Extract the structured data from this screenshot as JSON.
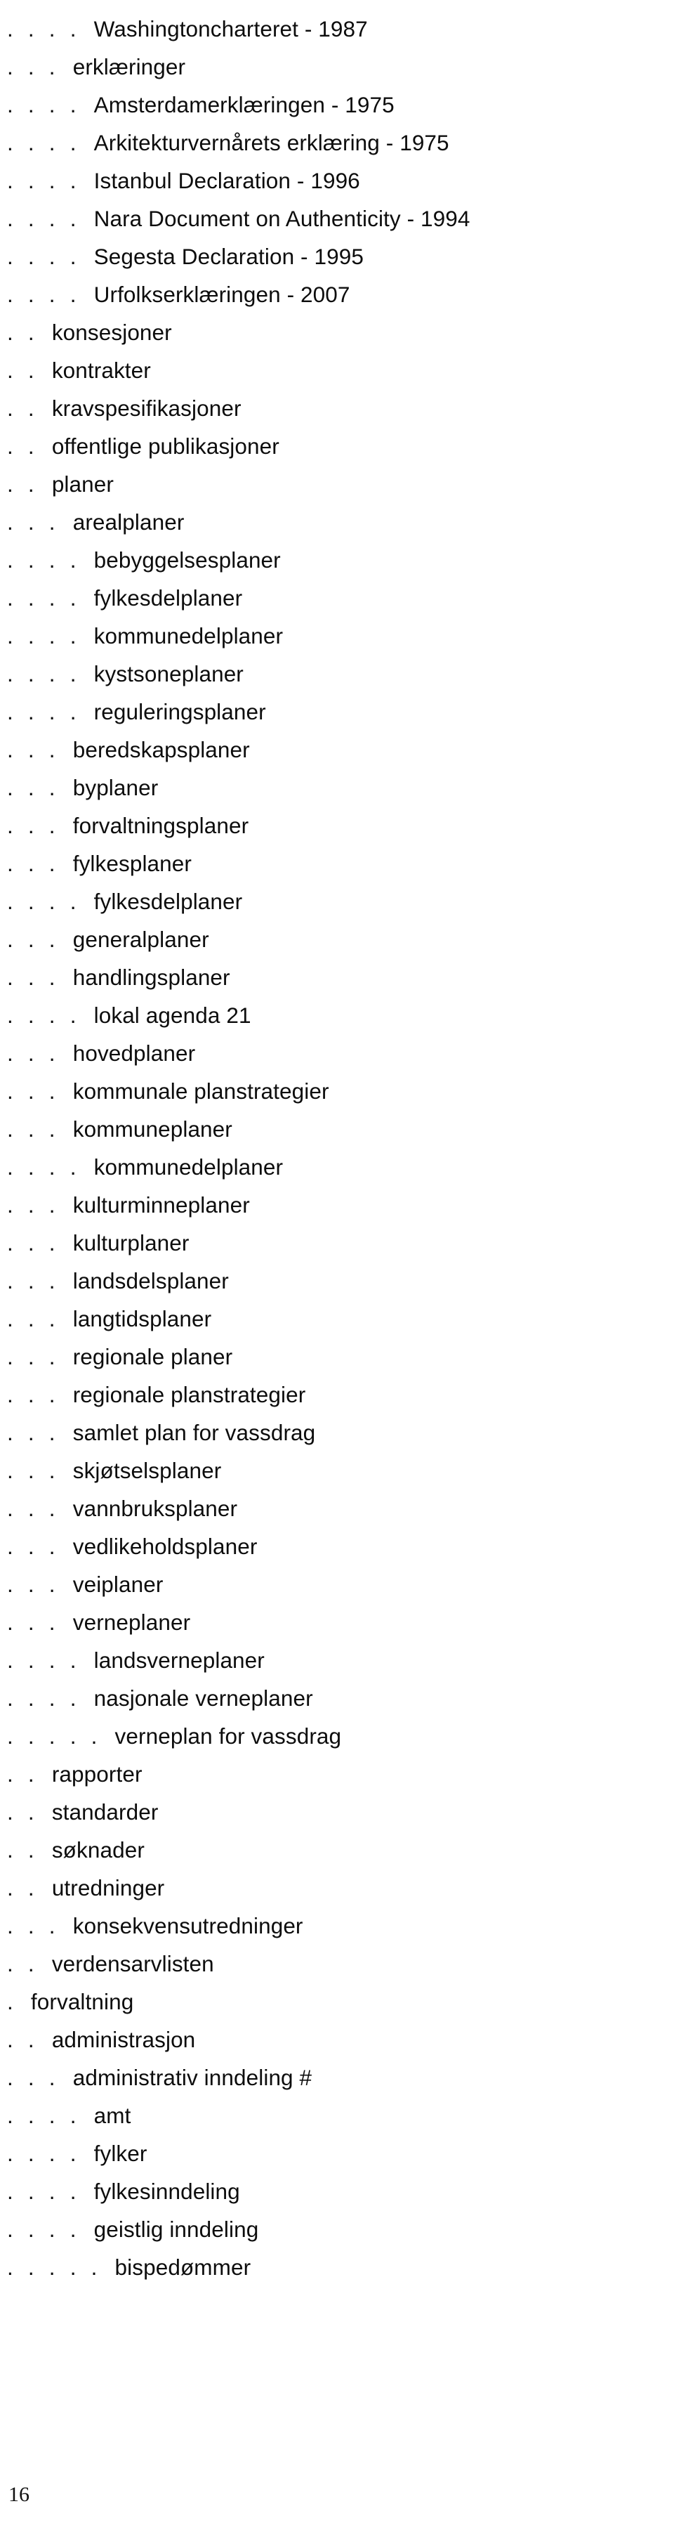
{
  "page": {
    "page_number": "16",
    "dot_char": "."
  },
  "entries": [
    {
      "depth": 4,
      "label": "Washingtoncharteret - 1987"
    },
    {
      "depth": 3,
      "label": "erklæringer"
    },
    {
      "depth": 4,
      "label": "Amsterdamerklæringen - 1975"
    },
    {
      "depth": 4,
      "label": "Arkitekturvernårets erklæring - 1975"
    },
    {
      "depth": 4,
      "label": "Istanbul Declaration - 1996"
    },
    {
      "depth": 4,
      "label": "Nara Document on Authenticity - 1994"
    },
    {
      "depth": 4,
      "label": "Segesta Declaration - 1995"
    },
    {
      "depth": 4,
      "label": "Urfolkserklæringen - 2007"
    },
    {
      "depth": 2,
      "label": "konsesjoner"
    },
    {
      "depth": 2,
      "label": "kontrakter"
    },
    {
      "depth": 2,
      "label": "kravspesifikasjoner"
    },
    {
      "depth": 2,
      "label": "offentlige publikasjoner"
    },
    {
      "depth": 2,
      "label": "planer"
    },
    {
      "depth": 3,
      "label": "arealplaner"
    },
    {
      "depth": 4,
      "label": "bebyggelsesplaner"
    },
    {
      "depth": 4,
      "label": "fylkesdelplaner"
    },
    {
      "depth": 4,
      "label": "kommunedelplaner"
    },
    {
      "depth": 4,
      "label": "kystsoneplaner"
    },
    {
      "depth": 4,
      "label": "reguleringsplaner"
    },
    {
      "depth": 3,
      "label": "beredskapsplaner"
    },
    {
      "depth": 3,
      "label": "byplaner"
    },
    {
      "depth": 3,
      "label": "forvaltningsplaner"
    },
    {
      "depth": 3,
      "label": "fylkesplaner"
    },
    {
      "depth": 4,
      "label": "fylkesdelplaner"
    },
    {
      "depth": 3,
      "label": "generalplaner"
    },
    {
      "depth": 3,
      "label": "handlingsplaner"
    },
    {
      "depth": 4,
      "label": "lokal agenda 21"
    },
    {
      "depth": 3,
      "label": "hovedplaner"
    },
    {
      "depth": 3,
      "label": "kommunale planstrategier"
    },
    {
      "depth": 3,
      "label": "kommuneplaner"
    },
    {
      "depth": 4,
      "label": "kommunedelplaner"
    },
    {
      "depth": 3,
      "label": "kulturminneplaner"
    },
    {
      "depth": 3,
      "label": "kulturplaner"
    },
    {
      "depth": 3,
      "label": "landsdelsplaner"
    },
    {
      "depth": 3,
      "label": "langtidsplaner"
    },
    {
      "depth": 3,
      "label": "regionale planer"
    },
    {
      "depth": 3,
      "label": "regionale planstrategier"
    },
    {
      "depth": 3,
      "label": "samlet plan for vassdrag"
    },
    {
      "depth": 3,
      "label": "skjøtselsplaner"
    },
    {
      "depth": 3,
      "label": "vannbruksplaner"
    },
    {
      "depth": 3,
      "label": "vedlikeholdsplaner"
    },
    {
      "depth": 3,
      "label": "veiplaner"
    },
    {
      "depth": 3,
      "label": "verneplaner"
    },
    {
      "depth": 4,
      "label": "landsverneplaner"
    },
    {
      "depth": 4,
      "label": "nasjonale verneplaner"
    },
    {
      "depth": 5,
      "label": "verneplan for vassdrag"
    },
    {
      "depth": 2,
      "label": "rapporter"
    },
    {
      "depth": 2,
      "label": "standarder"
    },
    {
      "depth": 2,
      "label": "søknader"
    },
    {
      "depth": 2,
      "label": "utredninger"
    },
    {
      "depth": 3,
      "label": "konsekvensutredninger"
    },
    {
      "depth": 2,
      "label": "verdensarvlisten"
    },
    {
      "depth": 1,
      "label": "forvaltning"
    },
    {
      "depth": 2,
      "label": "administrasjon"
    },
    {
      "depth": 3,
      "label": "administrativ inndeling #"
    },
    {
      "depth": 4,
      "label": "amt"
    },
    {
      "depth": 4,
      "label": "fylker"
    },
    {
      "depth": 4,
      "label": "fylkesinndeling"
    },
    {
      "depth": 4,
      "label": "geistlig inndeling"
    },
    {
      "depth": 5,
      "label": "bispedømmer"
    }
  ]
}
